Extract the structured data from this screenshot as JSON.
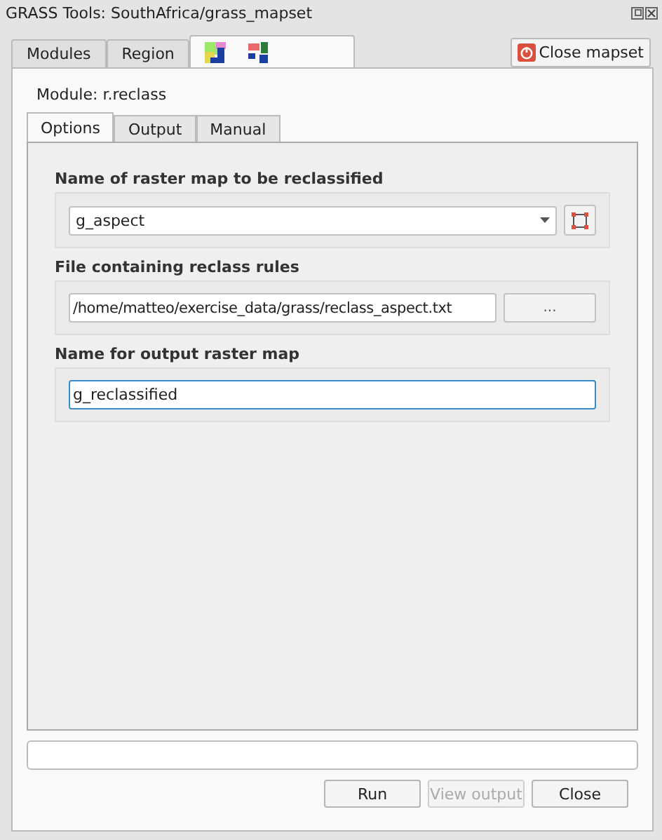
{
  "window": {
    "title": "GRASS Tools: SouthAfrica/grass_mapset"
  },
  "tabs": [
    {
      "kind": "text",
      "label": "Modules",
      "selected": false
    },
    {
      "kind": "text",
      "label": "Region",
      "selected": false
    },
    {
      "kind": "module-icons",
      "selected": true
    }
  ],
  "close_mapset_button": {
    "label": "Close mapset"
  },
  "module_label": "Module: r.reclass",
  "inner_tabs": [
    {
      "label": "Options",
      "selected": true
    },
    {
      "label": "Output",
      "selected": false
    },
    {
      "label": "Manual",
      "selected": false
    }
  ],
  "fields": [
    {
      "kind": "combo",
      "label": "Name of raster map to be reclassified",
      "value": "g_aspect",
      "focused": false
    },
    {
      "kind": "file",
      "label": "File containing reclass rules",
      "value": "/home/matteo/exercise_data/grass/reclass_aspect.txt",
      "button": "...",
      "focused": false
    },
    {
      "kind": "text",
      "label": "Name for output raster map",
      "value": "g_reclassified",
      "focused": true
    }
  ],
  "buttons": [
    {
      "label": "Run",
      "disabled": false
    },
    {
      "label": "View output",
      "disabled": true
    },
    {
      "label": "Close",
      "disabled": false
    }
  ]
}
